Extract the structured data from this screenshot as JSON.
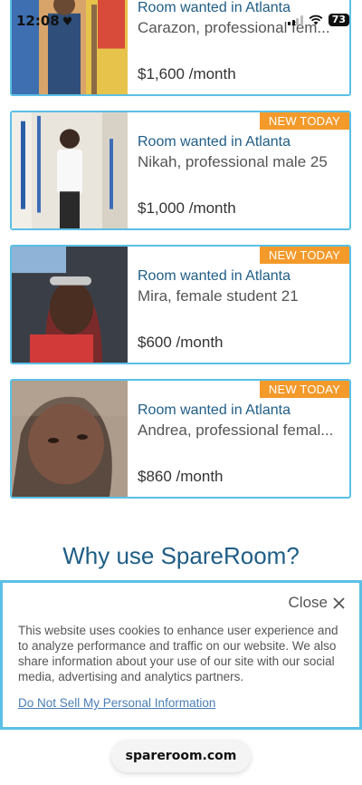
{
  "status_bar": {
    "time": "12:08",
    "heart": "♥",
    "battery": "73"
  },
  "listings": [
    {
      "title": "Room wanted in Atlanta",
      "subtitle": "Carazon, professional fem...",
      "price": "$1,600 /month",
      "badge": ""
    },
    {
      "title": "Room wanted in Atlanta",
      "subtitle": "Nikah, professional male 25",
      "price": "$1,000 /month",
      "badge": "NEW TODAY"
    },
    {
      "title": "Room wanted in Atlanta",
      "subtitle": "Mira, female student 21",
      "price": "$600 /month",
      "badge": "NEW TODAY"
    },
    {
      "title": "Room wanted in Atlanta",
      "subtitle": "Andrea, professional femal...",
      "price": "$860 /month",
      "badge": "NEW TODAY"
    }
  ],
  "why_heading": "Why use SpareRoom?",
  "cookie_banner": {
    "close_label": "Close",
    "text": "This website uses cookies to enhance user experience and to analyze performance and traffic on our website. We also share information about your use of our site with our social media, advertising and analytics partners.",
    "link": "Do Not Sell My Personal Information"
  },
  "url_bar": {
    "domain": "spareroom.com"
  },
  "colors": {
    "accent_border": "#5bc0e5",
    "badge_bg": "#f39a2b",
    "title_blue": "#1f5d86"
  }
}
